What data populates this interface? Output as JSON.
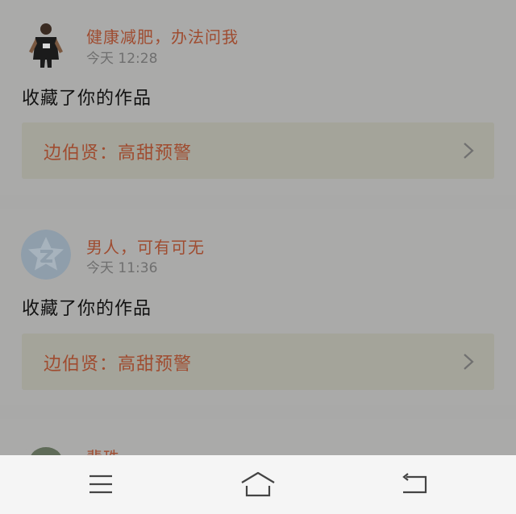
{
  "feed": {
    "items": [
      {
        "user_name": "健康减肥，办法问我",
        "time": "今天 12:28",
        "action": "收藏了你的作品",
        "work_title": "边伯贤：高甜预警",
        "avatar_icon": "person-photo-icon"
      },
      {
        "user_name": "男人，可有可无",
        "time": "今天 11:36",
        "action": "收藏了你的作品",
        "work_title": "边伯贤：高甜预警",
        "avatar_icon": "default-star-avatar-icon"
      },
      {
        "user_name": "翡珠",
        "avatar_icon": "cartoon-avatar-icon"
      }
    ]
  },
  "navbar": {
    "icons": [
      "menu-icon",
      "home-icon",
      "back-icon"
    ]
  },
  "colors": {
    "accent": "#9f4c30",
    "overlay_bg": "#a9a9a8",
    "navbar_bg": "#f5f5f5"
  }
}
